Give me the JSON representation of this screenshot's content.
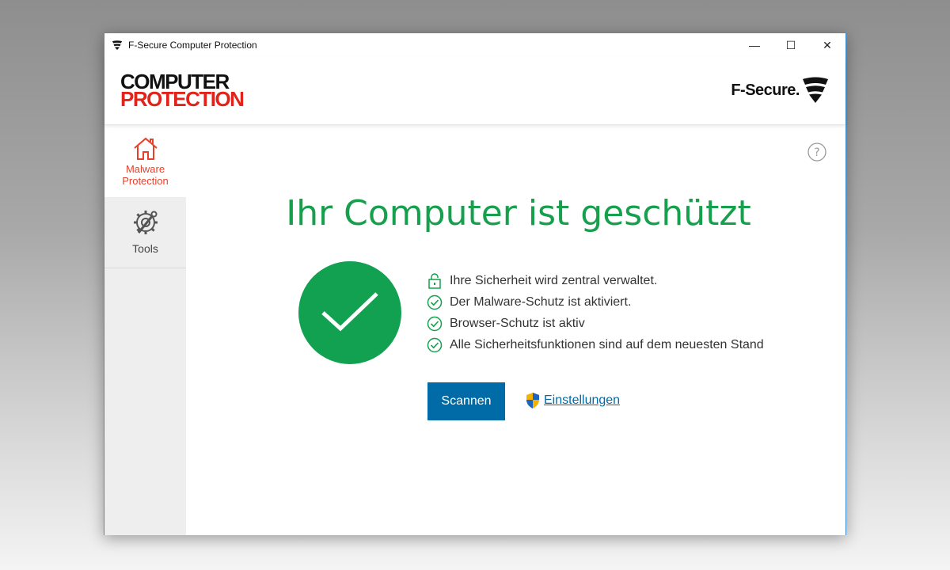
{
  "window": {
    "title": "F-Secure Computer Protection",
    "controls": {
      "minimize": "—",
      "maximize": "☐",
      "close": "✕"
    }
  },
  "header": {
    "brand_line1": "COMPUTER",
    "brand_line2": "PROTECTION",
    "vendor": "F-Secure."
  },
  "sidebar": {
    "items": [
      {
        "label": "Malware Protection",
        "icon": "home-icon",
        "active": true
      },
      {
        "label": "Tools",
        "icon": "tools-icon",
        "active": false
      }
    ]
  },
  "main": {
    "help_icon": "question-icon",
    "status_title": "Ihr Computer ist geschützt",
    "status_items": [
      {
        "text": "Ihre Sicherheit wird zentral verwaltet.",
        "icon": "lock-icon"
      },
      {
        "text": "Der Malware-Schutz ist aktiviert.",
        "icon": "check-circle-icon"
      },
      {
        "text": "Browser-Schutz ist aktiv",
        "icon": "check-circle-icon"
      },
      {
        "text": "Alle Sicherheitsfunktionen sind auf dem neuesten Stand",
        "icon": "check-circle-icon"
      }
    ],
    "scan_button": "Scannen",
    "settings_link": "Einstellungen"
  },
  "colors": {
    "accent_green": "#16a04d",
    "brand_red": "#e2231a",
    "button_blue": "#006ba6",
    "sidebar_active": "#e8402a"
  }
}
